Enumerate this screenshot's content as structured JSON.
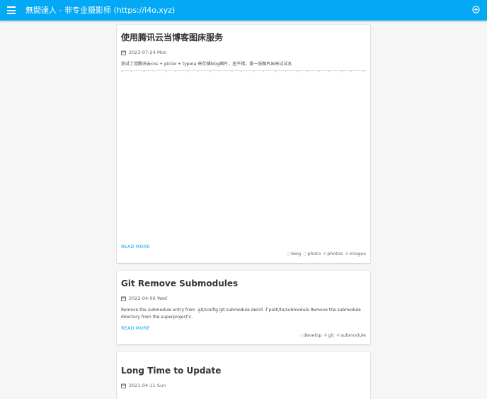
{
  "header": {
    "title": "無間達人 - 非专业摄影师 (https://i4o.xyz)",
    "menu_icon": "menu-icon",
    "action_icon": "add-circle-icon",
    "bg_color": "#03a9f4"
  },
  "posts": [
    {
      "title": "使用腾讯云当博客图床服务",
      "date": "2023-07-24 Mon",
      "excerpt": "测试了用腾讯云cos + picGo + typora 来存储blog图片，还不错，拿一张图片出来试试水",
      "read_more": "READ MORE",
      "tags": [
        {
          "icon": "○",
          "label": "blog"
        },
        {
          "icon": "○",
          "label": "photo"
        },
        {
          "icon": "#",
          "label": "photos"
        },
        {
          "icon": "#",
          "label": "images"
        }
      ]
    },
    {
      "title": "Git Remove Submodules",
      "date": "2022-04-06 Wed",
      "excerpt": "Remove the submodule entry from .git/config git submodule deinit -f path/to/submodule Remove the submodule directory from the superproject's .",
      "read_more": "READ MORE",
      "tags": [
        {
          "icon": "○",
          "label": "develop"
        },
        {
          "icon": "#",
          "label": "git"
        },
        {
          "icon": "#",
          "label": "submodule"
        }
      ]
    },
    {
      "title": "Long Time to Update",
      "date": "2021-04-11 Sun"
    }
  ]
}
